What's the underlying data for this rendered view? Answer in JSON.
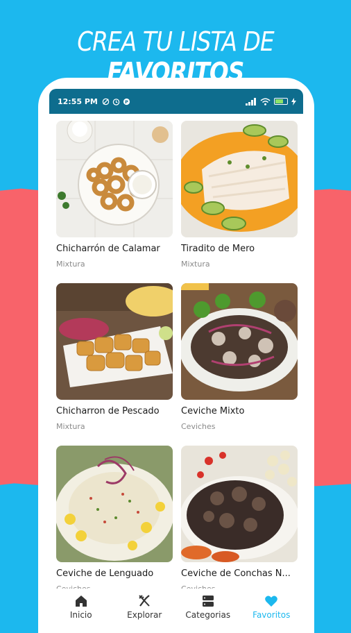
{
  "headline": {
    "prefix": "CREA TU LISTA DE",
    "emphasis": "FAVORITOS"
  },
  "status_bar": {
    "time": "12:55 PM"
  },
  "colors": {
    "accent": "#1cb8ee",
    "status_bar": "#0e6d8e",
    "band": "#f8636a"
  },
  "recipes": [
    {
      "title": "Chicharrón de Calamar",
      "category": "Mixtura"
    },
    {
      "title": "Tiradito de Mero",
      "category": "Mixtura"
    },
    {
      "title": "Chicharron de Pescado",
      "category": "Mixtura"
    },
    {
      "title": "Ceviche Mixto",
      "category": "Ceviches"
    },
    {
      "title": "Ceviche de Lenguado",
      "category": "Ceviches"
    },
    {
      "title": "Ceviche de Conchas N...",
      "category": "Ceviches"
    }
  ],
  "nav": [
    {
      "label": "Inicio",
      "icon": "home-icon"
    },
    {
      "label": "Explorar",
      "icon": "utensils-icon"
    },
    {
      "label": "Categorias",
      "icon": "categories-icon"
    },
    {
      "label": "Favoritos",
      "icon": "heart-icon",
      "active": true
    }
  ]
}
